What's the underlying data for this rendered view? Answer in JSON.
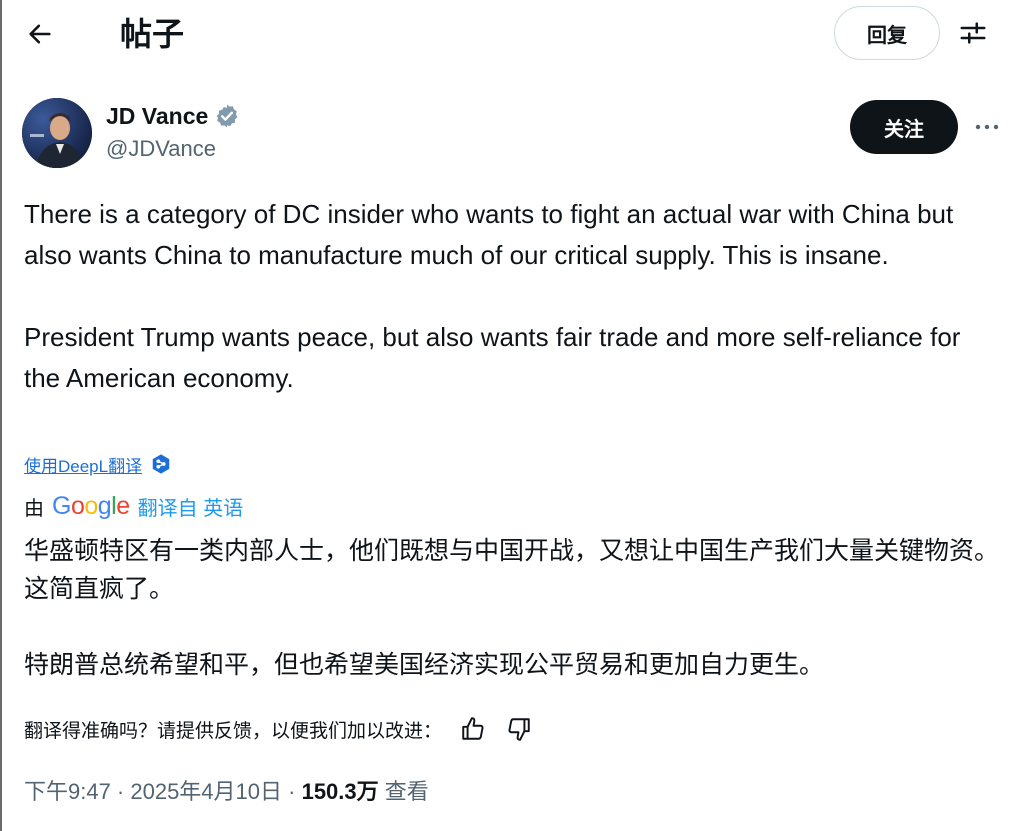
{
  "header": {
    "title": "帖子",
    "reply_label": "回复",
    "back_icon": "arrow-left-icon",
    "settings_icon": "sliders-icon"
  },
  "author": {
    "name": "JD Vance",
    "handle": "@JDVance",
    "verified_color": "#829aab",
    "follow_label": "关注",
    "more_icon": "ellipsis-icon"
  },
  "tweet": {
    "paragraphs": [
      "There is a category of DC insider who wants to fight an actual war with China but also wants China to manufacture much of our critical supply. This is insane.",
      "President Trump wants peace, but also wants fair trade and more self-reliance for the American economy."
    ]
  },
  "translation": {
    "deepl_link": "使用DeepL翻译",
    "by_label": "由",
    "google_letters": [
      "G",
      "o",
      "o",
      "g",
      "l",
      "e"
    ],
    "translated_from": "翻译自 英语",
    "paragraphs": [
      "华盛顿特区有一类内部人士，他们既想与中国开战，又想让中国生产我们大量关键物资。这简直疯了。",
      "特朗普总统希望和平，但也希望美国经济实现公平贸易和更加自力更生。"
    ],
    "feedback_prompt": "翻译得准确吗？请提供反馈，以便我们加以改进："
  },
  "meta": {
    "time_date": "下午9:47 · 2025年4月10日 · ",
    "views_count": "150.3万",
    "views_label": " 查看"
  },
  "colors": {
    "text_primary": "#0f1419",
    "text_secondary": "#536471",
    "link_blue": "#1d9bf0",
    "deepl_blue": "#1d6fd6"
  }
}
